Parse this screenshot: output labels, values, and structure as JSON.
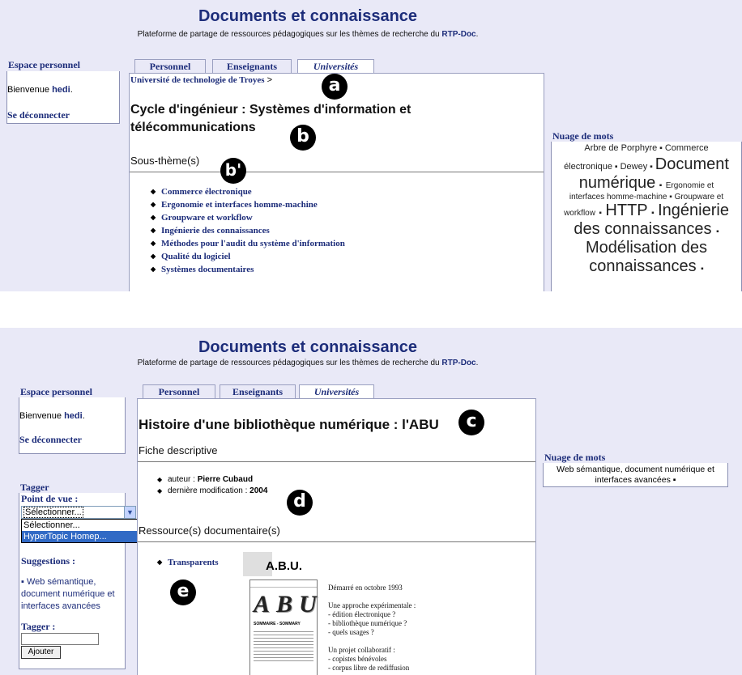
{
  "site": {
    "title": "Documents et connaissance",
    "subtitle_text": "Plateforme de partage de ressources pédagogiques sur les thèmes de recherche du",
    "subtitle_link": "RTP-Doc",
    "subtitle_end": "."
  },
  "sidebar": {
    "espace_title": "Espace personnel",
    "welcome_prefix": "Bienvenue",
    "username": "hedi",
    "welcome_suffix": ".",
    "logout": "Se déconnecter"
  },
  "tabs": [
    "Personnel",
    "Enseignants",
    "Universités"
  ],
  "cloud_title": "Nuage de mots",
  "markers": [
    "a",
    "b",
    "b'",
    "c",
    "d",
    "e"
  ],
  "top": {
    "breadcrumb": "Université de technologie de Troyes",
    "breadcrumb_sep": ">",
    "heading": "Cycle d'ingénieur : Systèmes d'information et télécommunications",
    "subthemes_title": "Sous-thème(s)",
    "subthemes": [
      "Commerce électronique",
      "Ergonomie et interfaces homme-machine",
      "Groupware et workflow",
      "Ingénierie des connaissances",
      "Méthodes pour l'audit du système d'information",
      "Qualité du logiciel",
      "Systèmes documentaires"
    ],
    "cloud": {
      "arbre": "Arbre de Porphyre",
      "commerce": "Commerce",
      "electronique": "électronique",
      "dewey": "Dewey",
      "document": "Document",
      "numerique": "numérique",
      "ergonomie": "Ergonomie et",
      "interfaces": "interfaces homme-machine",
      "groupware": "Groupware et",
      "workflow": "workflow",
      "http": "HTTP",
      "ingenierie": "Ingénierie",
      "des_connaissances": "des connaissances",
      "modelisation": "Modélisation des",
      "connaissances": "connaissances",
      "sep": "▪"
    }
  },
  "bottom": {
    "heading": "Histoire d'une bibliothèque numérique : l'ABU",
    "fiche_title": "Fiche descriptive",
    "author_label": "auteur :",
    "author_value": "Pierre Cubaud",
    "modif_label": "dernière modification :",
    "modif_value": "2004",
    "resources_title": "Ressource(s) documentaire(s)",
    "resource_link": "Transparents",
    "thumb": {
      "title": "A.B.U.",
      "big_letters": "ABU",
      "line1": "Démarré en octobre 1993",
      "line2": "Une approche expérimentale :",
      "line3": "- édition électronique ?",
      "line4": "- bibliothèque numérique ?",
      "line5": "- quels usages ?",
      "line6": "Un projet collaboratif :",
      "line7": "- copistes bénévoles",
      "line8": "- corpus libre de rediffusion",
      "caption": "SOMMAIRE - SOMMARY"
    },
    "tagger": {
      "title": "Tagger",
      "pov_label": "Point de vue :",
      "select_value": "Sélectionner...",
      "options": [
        "Sélectionner...",
        "HyperTopic Homep..."
      ],
      "suggestions_label": "Suggestions :",
      "suggestion_link": "Web sémantique, document numérique et interfaces avancées",
      "tagger_label": "Tagger :",
      "tag_input_value": "",
      "add_button": "Ajouter"
    },
    "cloud_text_1": "Web sémantique, document numérique et",
    "cloud_text_2": "interfaces avancées",
    "cloud_sep": "▪"
  }
}
